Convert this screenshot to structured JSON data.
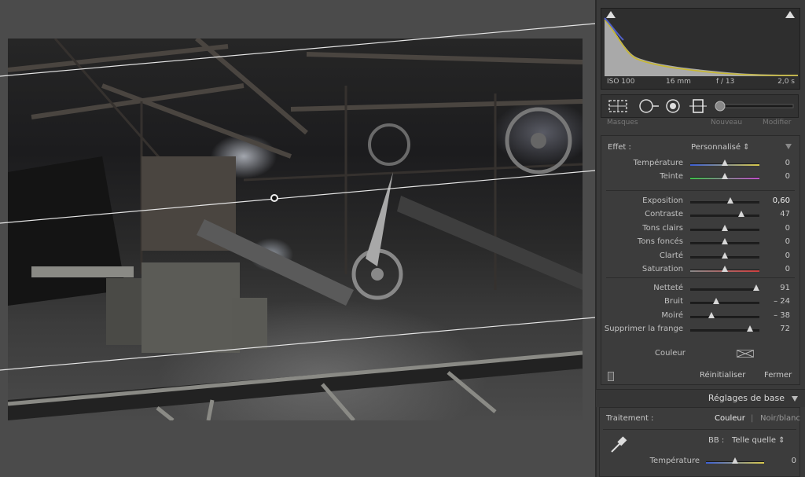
{
  "histogram": {
    "iso": "ISO 100",
    "focal": "16 mm",
    "aperture": "f / 13",
    "shutter": "2,0 s"
  },
  "peek": {
    "left": "Masques",
    "middle": "Nouveau",
    "right": "Modifier"
  },
  "mask_panel": {
    "effect_label": "Effet :",
    "effect_value": "Personnalisé ⇕",
    "groups": [
      [
        {
          "label": "Température",
          "value": "0",
          "pos": 0.5,
          "track": "temp"
        },
        {
          "label": "Teinte",
          "value": "0",
          "pos": 0.5,
          "track": "tint"
        }
      ],
      [
        {
          "label": "Exposition",
          "value": "0,60",
          "pos": 0.575,
          "track": "plain",
          "bright": true
        },
        {
          "label": "Contraste",
          "value": "47",
          "pos": 0.735,
          "track": "plain"
        },
        {
          "label": "Tons clairs",
          "value": "0",
          "pos": 0.5,
          "track": "plain"
        },
        {
          "label": "Tons foncés",
          "value": "0",
          "pos": 0.5,
          "track": "plain"
        },
        {
          "label": "Clarté",
          "value": "0",
          "pos": 0.5,
          "track": "plain"
        },
        {
          "label": "Saturation",
          "value": "0",
          "pos": 0.5,
          "track": "sat"
        }
      ],
      [
        {
          "label": "Netteté",
          "value": "91",
          "pos": 0.955,
          "track": "plain"
        },
        {
          "label": "Bruit",
          "value": "– 24",
          "pos": 0.38,
          "track": "plain"
        },
        {
          "label": "Moiré",
          "value": "– 38",
          "pos": 0.31,
          "track": "plain"
        },
        {
          "label": "Supprimer la frange",
          "value": "72",
          "pos": 0.86,
          "track": "plain"
        }
      ]
    ],
    "color_label": "Couleur",
    "reset": "Réinitialiser",
    "close": "Fermer"
  },
  "basic": {
    "section_title": "Réglages de base",
    "treatment_label": "Traitement :",
    "treatment_color": "Couleur",
    "treatment_sep": "|",
    "treatment_bw": "Noir/blanc",
    "wb_label": "BB :",
    "wb_value": "Telle quelle ⇕",
    "temp": {
      "label": "Température",
      "value": "0",
      "pos": 0.5,
      "track": "temp"
    }
  },
  "colors": {
    "temp_start": "#3c5fd6",
    "temp_end": "#d8c84a",
    "tint_start": "#3fbf4a",
    "tint_end": "#c04fc9",
    "sat_start": "#8a8a8a",
    "sat_end": "#d04040",
    "hist_yellow": "#c8b830",
    "hist_blue": "#5060c8"
  },
  "icons": {
    "tool1": "crop-overlay-icon",
    "tool2": "spot-removal-icon",
    "tool3": "red-eye-icon",
    "tool4": "graduated-filter-icon",
    "tool5": "adjustment-brush-slider-icon"
  }
}
